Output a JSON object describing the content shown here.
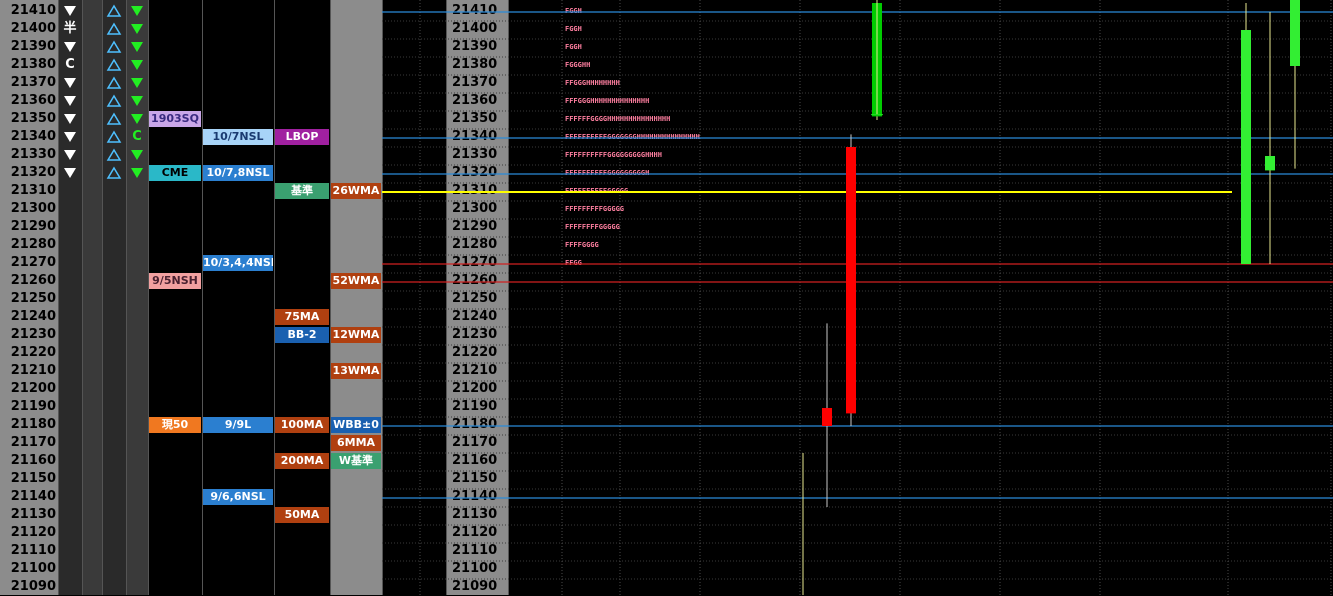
{
  "price_axis": {
    "prices": [
      21410,
      21400,
      21390,
      21380,
      21370,
      21360,
      21350,
      21340,
      21330,
      21320,
      21310,
      21300,
      21290,
      21280,
      21270,
      21260,
      21250,
      21240,
      21230,
      21220,
      21210,
      21200,
      21190,
      21180,
      21170,
      21160,
      21150,
      21140,
      21130,
      21120,
      21110,
      21100,
      21090
    ]
  },
  "markers": {
    "col1": {
      "21400": "半",
      "21380": "C"
    },
    "col3": {
      "21340": "C"
    }
  },
  "levels": [
    {
      "text": "1903SQ",
      "price": 21350,
      "col": "c1",
      "bg": "#c9a6e8",
      "fg": "#3a2a80"
    },
    {
      "text": "CME",
      "price": 21320,
      "col": "c1",
      "bg": "#2ab8c8",
      "fg": "#000000"
    },
    {
      "text": "9/5NSH",
      "price": 21260,
      "col": "c1",
      "bg": "#f2a0a0",
      "fg": "#4a2030"
    },
    {
      "text": "現50",
      "price": 21180,
      "col": "c1",
      "bg": "#f07820",
      "fg": "#ffffff"
    },
    {
      "text": "10/7NSL",
      "price": 21340,
      "col": "c2",
      "bg": "#a8d4f8",
      "fg": "#1a3a70"
    },
    {
      "text": "10/7,8NSL",
      "price": 21320,
      "col": "c2",
      "bg": "#2b7fd0",
      "fg": "#ffffff"
    },
    {
      "text": "10/3,4,4NSL",
      "price": 21270,
      "col": "c2",
      "bg": "#2b7fd0",
      "fg": "#ffffff"
    },
    {
      "text": "9/9L",
      "price": 21180,
      "col": "c2",
      "bg": "#2b7fd0",
      "fg": "#ffffff"
    },
    {
      "text": "9/6,6NSL",
      "price": 21140,
      "col": "c2",
      "bg": "#2b7fd0",
      "fg": "#ffffff"
    },
    {
      "text": "LBOP",
      "price": 21340,
      "col": "c3",
      "bg": "#a020a0",
      "fg": "#ffffff"
    },
    {
      "text": "基準",
      "price": 21310,
      "col": "c3",
      "bg": "#3aa070",
      "fg": "#ffffff"
    },
    {
      "text": "75MA",
      "price": 21240,
      "col": "c3",
      "bg": "#b04010",
      "fg": "#ffffff"
    },
    {
      "text": "BB-2",
      "price": 21230,
      "col": "c3",
      "bg": "#1a60b0",
      "fg": "#ffffff"
    },
    {
      "text": "100MA",
      "price": 21180,
      "col": "c3",
      "bg": "#b04010",
      "fg": "#ffffff"
    },
    {
      "text": "200MA",
      "price": 21160,
      "col": "c3",
      "bg": "#b04010",
      "fg": "#ffffff"
    },
    {
      "text": "50MA",
      "price": 21130,
      "col": "c3",
      "bg": "#b04010",
      "fg": "#ffffff"
    },
    {
      "text": "26WMA",
      "price": 21310,
      "col": "c4",
      "bg": "#b04010",
      "fg": "#ffffff"
    },
    {
      "text": "52WMA",
      "price": 21260,
      "col": "c4",
      "bg": "#b04010",
      "fg": "#ffffff"
    },
    {
      "text": "12WMA",
      "price": 21230,
      "col": "c4",
      "bg": "#b04010",
      "fg": "#ffffff"
    },
    {
      "text": "13WMA",
      "price": 21210,
      "col": "c4",
      "bg": "#b04010",
      "fg": "#ffffff"
    },
    {
      "text": "WBB±0",
      "price": 21180,
      "col": "c4",
      "bg": "#1a60b0",
      "fg": "#ffffff"
    },
    {
      "text": "6MMA",
      "price": 21170,
      "col": "c4",
      "bg": "#b04010",
      "fg": "#ffffff"
    },
    {
      "text": "W基準",
      "price": 21160,
      "col": "c4",
      "bg": "#3aa070",
      "fg": "#ffffff"
    }
  ],
  "tpo_profile": [
    {
      "price": 21410,
      "letters": "FGGH"
    },
    {
      "price": 21400,
      "letters": "FGGH"
    },
    {
      "price": 21390,
      "letters": "FGGH"
    },
    {
      "price": 21380,
      "letters": "FGGGHH"
    },
    {
      "price": 21370,
      "letters": "FFGGGHHHHHHHH"
    },
    {
      "price": 21360,
      "letters": "FFFGGGHHHHHHHHHHHHHH"
    },
    {
      "price": 21350,
      "letters": "FFFFFFGGGGHHHHHHHHHHHHHHH"
    },
    {
      "price": 21340,
      "letters": "FFFFFFFFFFGGGGGGGHHHHHHHHHHHHHHH"
    },
    {
      "price": 21330,
      "letters": "FFFFFFFFFFGGGGGGGGGHHHH"
    },
    {
      "price": 21320,
      "letters": "FFFFFFFFFFGGGGGGGGGH"
    },
    {
      "price": 21310,
      "letters": "FFFFFFFFFFGGGGG"
    },
    {
      "price": 21300,
      "letters": "FFFFFFFFFGGGGG"
    },
    {
      "price": 21290,
      "letters": "FFFFFFFFGGGGG"
    },
    {
      "price": 21280,
      "letters": "FFFFGGGG"
    },
    {
      "price": 21270,
      "letters": "FFGG"
    }
  ],
  "chart_data": {
    "type": "candlestick",
    "y_ticks": [
      21410,
      21400,
      21390,
      21380,
      21370,
      21360,
      21350,
      21340,
      21330,
      21320,
      21310,
      21300,
      21290,
      21280,
      21270,
      21260,
      21250,
      21240,
      21230,
      21220,
      21210,
      21200,
      21190,
      21180,
      21170,
      21160,
      21150,
      21140,
      21130,
      21120,
      21110,
      21100,
      21090
    ],
    "ylim": [
      21088,
      21413
    ],
    "candles": [
      {
        "open": 21190,
        "close": 21180,
        "high": 21237,
        "low": 21135,
        "color": "#ff0000"
      },
      {
        "open": 21335,
        "close": 21187,
        "high": 21342,
        "low": 21180,
        "color": "#ff0000"
      },
      {
        "open": 21415,
        "close": 21352,
        "high": 21415,
        "low": 21350,
        "color": "#00cc00"
      },
      {
        "open": 21270,
        "close": 21400,
        "high": 21415,
        "low": 21270,
        "color": "#33ee33"
      },
      {
        "open": 21322,
        "close": 21330,
        "high": 21410,
        "low": 21270,
        "color": "#33ee33"
      },
      {
        "open": 21380,
        "close": 21425,
        "high": 21425,
        "low": 21323,
        "color": "#33ee33"
      }
    ],
    "h_lines": [
      {
        "price": 21410,
        "color": "#2a8ad8"
      },
      {
        "price": 21340,
        "color": "#2a8ad8"
      },
      {
        "price": 21320,
        "color": "#2a8ad8"
      },
      {
        "price": 21310,
        "color": "#ffff00"
      },
      {
        "price": 21270,
        "color": "#d02020"
      },
      {
        "price": 21260,
        "color": "#d02020"
      },
      {
        "price": 21180,
        "color": "#2a8ad8"
      },
      {
        "price": 21140,
        "color": "#2a8ad8"
      }
    ]
  }
}
